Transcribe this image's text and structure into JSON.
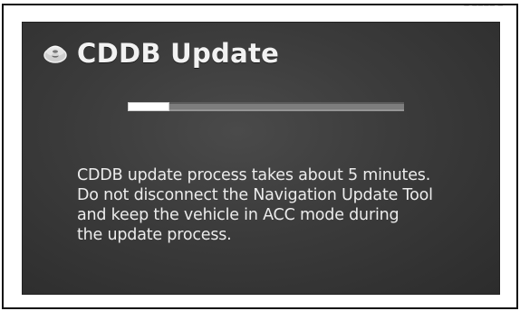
{
  "window": {
    "corner_mark": "— ———— —"
  },
  "header": {
    "icon": "disc-icon",
    "title": "CDDB Update"
  },
  "progress": {
    "value_fraction": 0.15
  },
  "message": {
    "lines": [
      "CDDB update process takes about 5 minutes.",
      "Do not disconnect the Navigation Update Tool",
      "and keep the vehicle in ACC mode during",
      "the update process."
    ]
  },
  "colors": {
    "screen_bg": "#3b3b3b",
    "text": "#ececec",
    "progress_fill": "#ffffff",
    "progress_track": "#7d7d7d"
  }
}
